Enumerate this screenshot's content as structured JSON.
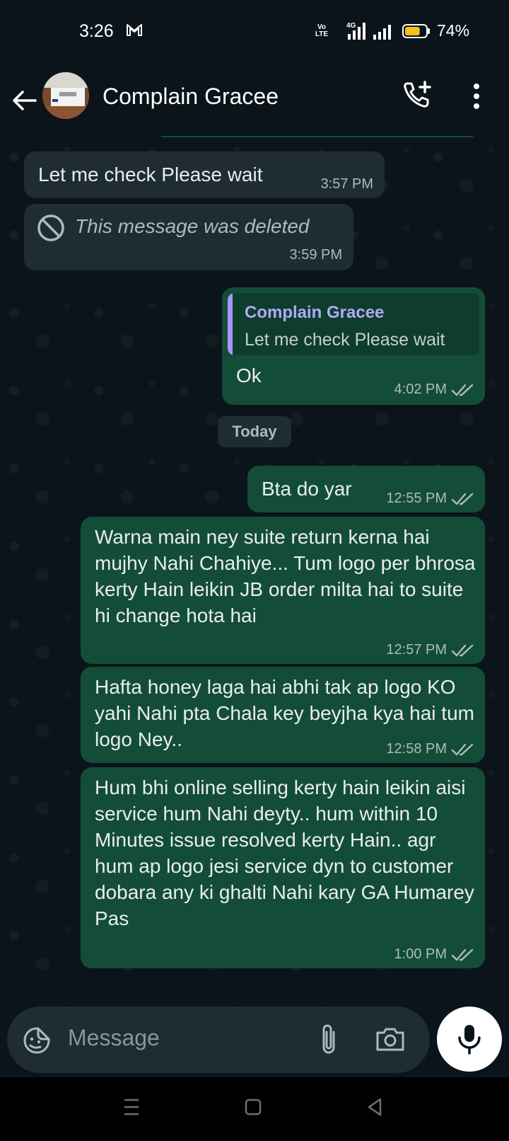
{
  "status_bar": {
    "time": "3:26",
    "volte_label": "Vo\nLTE",
    "network_label": "4G",
    "battery_percent": "74%",
    "battery_level": 0.74
  },
  "header": {
    "title": "Complain Gracee",
    "icons": [
      "back-arrow-icon",
      "call-add-icon",
      "more-vert-icon"
    ]
  },
  "messages": [
    {
      "direction": "in",
      "text": "Let me check Please wait",
      "time": "3:57 PM"
    },
    {
      "direction": "in",
      "deleted": true,
      "text": "This message was deleted",
      "time": "3:59 PM"
    },
    {
      "direction": "out",
      "quote": {
        "author": "Complain Gracee",
        "text": "Let me check Please wait"
      },
      "text": "Ok",
      "time": "4:02 PM",
      "status": "read"
    },
    {
      "type": "date",
      "text": "Today"
    },
    {
      "direction": "out",
      "text": "Bta do yar",
      "time": "12:55 PM",
      "status": "read"
    },
    {
      "direction": "out",
      "text": "Warna main ney suite return kerna hai mujhy Nahi Chahiye... Tum logo per bhrosa kerty Hain leikin JB order milta hai to suite hi change hota hai",
      "time": "12:57 PM",
      "status": "read"
    },
    {
      "direction": "out",
      "text": "Hafta honey laga hai abhi tak ap logo KO yahi Nahi pta Chala key beyjha kya hai tum logo Ney..",
      "time": "12:58 PM",
      "status": "read"
    },
    {
      "direction": "out",
      "text": "Hum bhi online selling kerty hain leikin aisi service hum Nahi deyty.. hum within 10 Minutes issue resolved kerty Hain.. agr hum ap logo jesi service dyn to customer dobara any ki ghalti Nahi kary GA Humarey Pas",
      "time": "1:00 PM",
      "status": "read"
    }
  ],
  "composer": {
    "placeholder": "Message"
  },
  "colors": {
    "background": "#0b141a",
    "incoming_bubble": "#1f2c33",
    "outgoing_bubble": "#144d37",
    "quote_author": "#b4a7ff",
    "meta_text": "#aebac1"
  }
}
